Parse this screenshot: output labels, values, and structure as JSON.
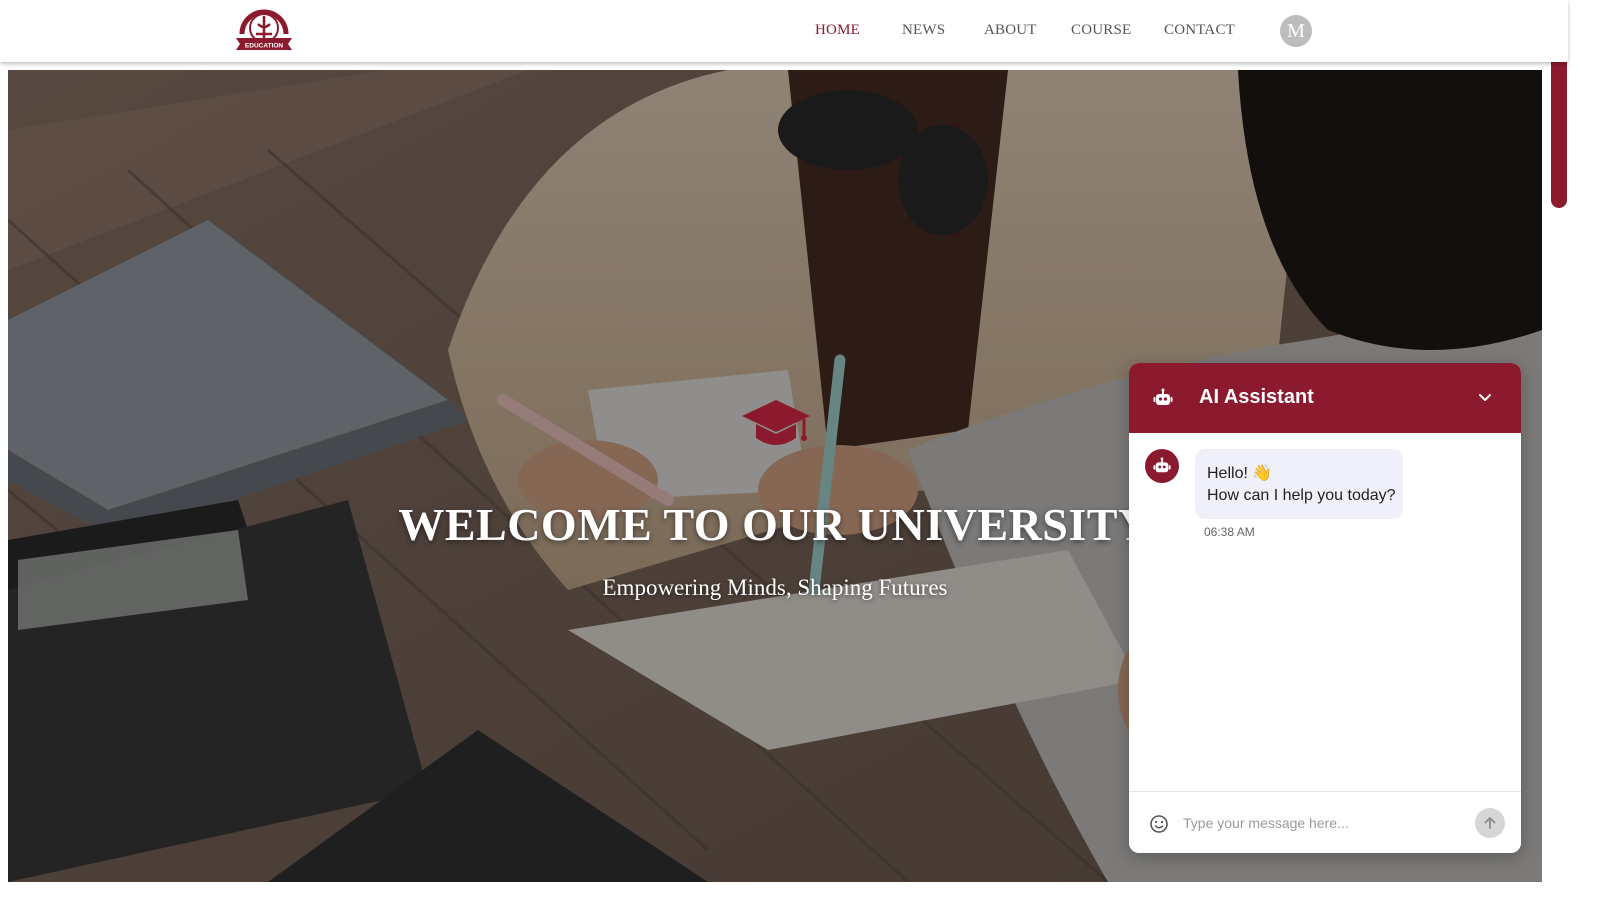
{
  "header": {
    "logo_text": "EDUCATION",
    "nav": [
      {
        "label": "HOME",
        "active": true
      },
      {
        "label": "NEWS",
        "active": false
      },
      {
        "label": "ABOUT",
        "active": false
      },
      {
        "label": "COURSE",
        "active": false
      },
      {
        "label": "CONTACT",
        "active": false
      }
    ],
    "avatar_initial": "M"
  },
  "hero": {
    "icon": "graduation-cap-icon",
    "title": "WELCOME TO OUR UNIVERSITY",
    "subtitle": "Empowering Minds, Shaping Futures"
  },
  "chat": {
    "title": "AI Assistant",
    "header_icon": "robot-icon",
    "collapse_icon": "chevron-down-icon",
    "messages": [
      {
        "sender": "bot",
        "line1": "Hello! 👋",
        "line2": "How can I help you today?",
        "time": "06:38 AM"
      }
    ],
    "input_placeholder": "Type your message here...",
    "input_value": "",
    "emoji_icon": "smiley-icon",
    "send_icon": "arrow-up-icon"
  },
  "colors": {
    "brand": "#8b1a2e",
    "nav_text": "#555555",
    "bubble_bg": "#f0f0fa"
  }
}
